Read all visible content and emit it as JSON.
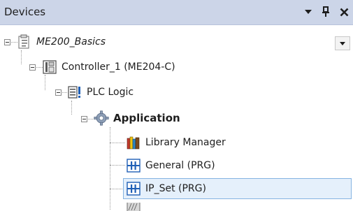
{
  "panel": {
    "title": "Devices"
  },
  "tree": {
    "nodes": [
      {
        "label": "ME200_Basics",
        "icon": "project-icon",
        "style": "italic"
      },
      {
        "label": "Controller_1 (ME204-C)",
        "icon": "controller-icon",
        "style": "normal"
      },
      {
        "label": "PLC Logic",
        "icon": "plc-logic-icon",
        "style": "normal"
      },
      {
        "label": "Application",
        "icon": "gear-icon",
        "style": "bold"
      },
      {
        "label": "Library Manager",
        "icon": "library-icon",
        "style": "normal"
      },
      {
        "label": "General (PRG)",
        "icon": "program-icon",
        "style": "normal"
      },
      {
        "label": "IP_Set (PRG)",
        "icon": "program-icon",
        "style": "normal",
        "selected": true
      }
    ]
  },
  "colors": {
    "titlebar_bg": "#ccd5e8",
    "selection_bg": "#e5f0fb",
    "selection_border": "#85b3e2",
    "program_icon_blue": "#1f5fb6"
  }
}
